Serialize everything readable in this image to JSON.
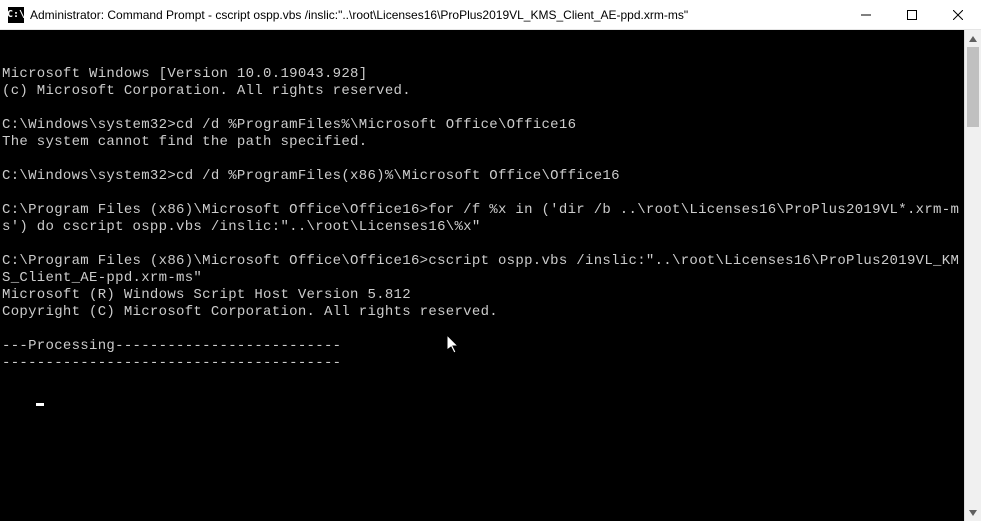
{
  "window": {
    "title": "Administrator: Command Prompt - cscript  ospp.vbs /inslic:\"..\\root\\Licenses16\\ProPlus2019VL_KMS_Client_AE-ppd.xrm-ms\"",
    "icon_glyph": "C:\\"
  },
  "terminal": {
    "lines": [
      "Microsoft Windows [Version 10.0.19043.928]",
      "(c) Microsoft Corporation. All rights reserved.",
      "",
      "C:\\Windows\\system32>cd /d %ProgramFiles%\\Microsoft Office\\Office16",
      "The system cannot find the path specified.",
      "",
      "C:\\Windows\\system32>cd /d %ProgramFiles(x86)%\\Microsoft Office\\Office16",
      "",
      "C:\\Program Files (x86)\\Microsoft Office\\Office16>for /f %x in ('dir /b ..\\root\\Licenses16\\ProPlus2019VL*.xrm-ms') do cscript ospp.vbs /inslic:\"..\\root\\Licenses16\\%x\"",
      "",
      "C:\\Program Files (x86)\\Microsoft Office\\Office16>cscript ospp.vbs /inslic:\"..\\root\\Licenses16\\ProPlus2019VL_KMS_Client_AE-ppd.xrm-ms\"",
      "Microsoft (R) Windows Script Host Version 5.812",
      "Copyright (C) Microsoft Corporation. All rights reserved.",
      "",
      "---Processing--------------------------",
      "---------------------------------------"
    ]
  }
}
